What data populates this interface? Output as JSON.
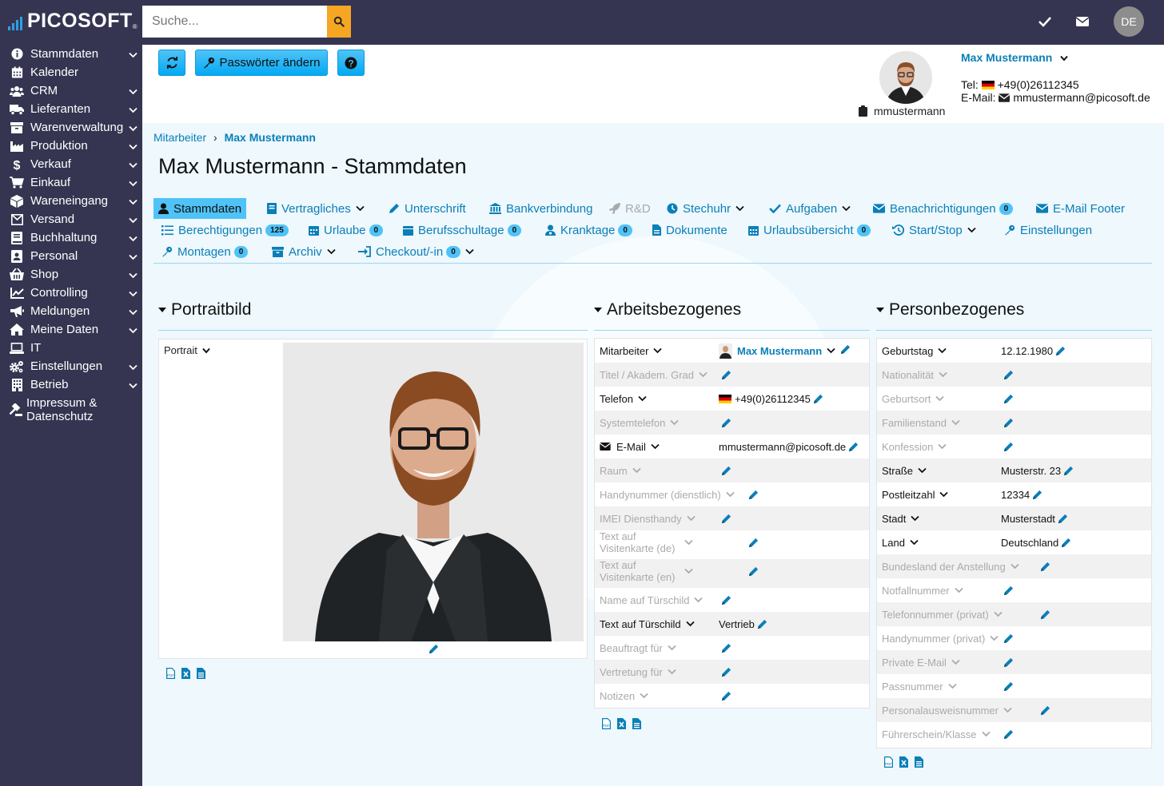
{
  "brand": {
    "name": "PICOSOFT",
    "mark": "®",
    "accent": "#2e9fe6",
    "sidebar_bg": "#353551"
  },
  "search": {
    "placeholder": "Suche..."
  },
  "topbar": {
    "lang": "DE",
    "icons": [
      "check-icon",
      "envelope-icon"
    ]
  },
  "sidebar": {
    "items": [
      {
        "label": "Stammdaten",
        "icon": "info-icon",
        "expandable": true
      },
      {
        "label": "Kalender",
        "icon": "calendar-icon",
        "expandable": false
      },
      {
        "label": "CRM",
        "icon": "users-icon",
        "expandable": true
      },
      {
        "label": "Lieferanten",
        "icon": "truck-icon",
        "expandable": true
      },
      {
        "label": "Warenverwaltung",
        "icon": "archive-icon",
        "expandable": true
      },
      {
        "label": "Produktion",
        "icon": "industry-icon",
        "expandable": true
      },
      {
        "label": "Verkauf",
        "icon": "dollar-icon",
        "expandable": true
      },
      {
        "label": "Einkauf",
        "icon": "cart-icon",
        "expandable": true
      },
      {
        "label": "Wareneingang",
        "icon": "box-icon",
        "expandable": true
      },
      {
        "label": "Versand",
        "icon": "envelope-box-icon",
        "expandable": true
      },
      {
        "label": "Buchhaltung",
        "icon": "book-icon",
        "expandable": true
      },
      {
        "label": "Personal",
        "icon": "id-card-icon",
        "expandable": true
      },
      {
        "label": "Shop",
        "icon": "basket-icon",
        "expandable": true
      },
      {
        "label": "Controlling",
        "icon": "line-chart-icon",
        "expandable": true
      },
      {
        "label": "Meldungen",
        "icon": "bullhorn-icon",
        "expandable": true
      },
      {
        "label": "Meine Daten",
        "icon": "home-icon",
        "expandable": true
      },
      {
        "label": "IT",
        "icon": "laptop-icon",
        "expandable": false
      },
      {
        "label": "Einstellungen",
        "icon": "cogs-icon",
        "expandable": true
      },
      {
        "label": "Betrieb",
        "icon": "building-icon",
        "expandable": true
      }
    ],
    "impressum": {
      "line1": "Impressum &",
      "line2": "Datenschutz"
    }
  },
  "toolbar": {
    "refresh": "refresh-icon",
    "passwords": "Passwörter ändern",
    "help": "question-icon"
  },
  "profile": {
    "name": "Max Mustermann",
    "tel_label": "Tel:",
    "tel": "+49(0)26112345",
    "email_label": "E-Mail:",
    "email": "mmustermann@picosoft.de",
    "username": "mmustermann"
  },
  "breadcrumb": {
    "parent": "Mitarbeiter",
    "sep": "›",
    "current": "Max Mustermann"
  },
  "page": {
    "title": "Max Mustermann - Stammdaten"
  },
  "tabs": [
    {
      "label": "Stammdaten",
      "active": true
    },
    {
      "label": "Vertragliches",
      "dropdown": true
    },
    {
      "label": "Unterschrift"
    },
    {
      "label": "Bankverbindung"
    },
    {
      "label": "R&D",
      "disabled": true
    },
    {
      "label": "Stechuhr",
      "dropdown": true
    },
    {
      "label": "Aufgaben",
      "dropdown": true
    },
    {
      "label": "Benachrichtigungen",
      "badge": "0"
    },
    {
      "label": "E-Mail Footer"
    },
    {
      "label": "Berechtigungen",
      "badge": "125"
    },
    {
      "label": "Urlaube",
      "badge": "0"
    },
    {
      "label": "Berufsschultage",
      "badge": "0"
    },
    {
      "label": "Kranktage",
      "badge": "0"
    },
    {
      "label": "Dokumente"
    },
    {
      "label": "Urlaubsübersicht",
      "badge": "0"
    },
    {
      "label": "Start/Stop",
      "dropdown": true
    },
    {
      "label": "Einstellungen"
    },
    {
      "label": "Montagen",
      "badge": "0"
    },
    {
      "label": "Archiv",
      "dropdown": true
    },
    {
      "label": "Checkout/-in",
      "badge": "0",
      "dropdown": true
    }
  ],
  "sections": {
    "portrait": {
      "title": "Portraitbild",
      "label": "Portrait"
    },
    "work": {
      "title": "Arbeitsbezogenes",
      "rows": [
        {
          "label": "Mitarbeiter",
          "value": "Max Mustermann",
          "set": true,
          "link": true
        },
        {
          "label": "Titel / Akadem. Grad",
          "value": "",
          "set": false
        },
        {
          "label": "Telefon",
          "value": "+49(0)26112345",
          "set": true,
          "flag": true
        },
        {
          "label": "Systemtelefon",
          "value": "",
          "set": false
        },
        {
          "label": "E-Mail",
          "value": "mmustermann@picosoft.de",
          "set": true,
          "envelope": true
        },
        {
          "label": "Raum",
          "value": "",
          "set": false
        },
        {
          "label": "Handynummer (dienstlich)",
          "value": "",
          "set": false
        },
        {
          "label": "IMEI Diensthandy",
          "value": "",
          "set": false
        },
        {
          "label": "Text auf Visitenkarte (de)",
          "value": "",
          "set": false
        },
        {
          "label": "Text auf Visitenkarte (en)",
          "value": "",
          "set": false
        },
        {
          "label": "Name auf Türschild",
          "value": "",
          "set": false
        },
        {
          "label": "Text auf Türschild",
          "value": "Vertrieb",
          "set": true
        },
        {
          "label": "Beauftragt für",
          "value": "",
          "set": false
        },
        {
          "label": "Vertretung für",
          "value": "",
          "set": false
        },
        {
          "label": "Notizen",
          "value": "",
          "set": false
        }
      ]
    },
    "person": {
      "title": "Personbezogenes",
      "rows": [
        {
          "label": "Geburtstag",
          "value": "12.12.1980",
          "set": true
        },
        {
          "label": "Nationalität",
          "value": "",
          "set": false
        },
        {
          "label": "Geburtsort",
          "value": "",
          "set": false
        },
        {
          "label": "Familienstand",
          "value": "",
          "set": false
        },
        {
          "label": "Konfession",
          "value": "",
          "set": false
        },
        {
          "label": "Straße",
          "value": "Musterstr. 23",
          "set": true
        },
        {
          "label": "Postleitzahl",
          "value": "12334",
          "set": true
        },
        {
          "label": "Stadt",
          "value": "Musterstadt",
          "set": true
        },
        {
          "label": "Land",
          "value": "Deutschland",
          "set": true
        },
        {
          "label": "Bundesland der Anstellung",
          "value": "",
          "set": false
        },
        {
          "label": "Notfallnummer",
          "value": "",
          "set": false
        },
        {
          "label": "Telefonnummer (privat)",
          "value": "",
          "set": false
        },
        {
          "label": "Handynummer (privat)",
          "value": "",
          "set": false
        },
        {
          "label": "Private E-Mail",
          "value": "",
          "set": false
        },
        {
          "label": "Passnummer",
          "value": "",
          "set": false
        },
        {
          "label": "Personalausweisnummer",
          "value": "",
          "set": false
        },
        {
          "label": "Führerschein/Klasse",
          "value": "",
          "set": false
        }
      ]
    }
  },
  "export_icons": [
    "pdf-icon",
    "excel-icon",
    "doc-icon"
  ]
}
